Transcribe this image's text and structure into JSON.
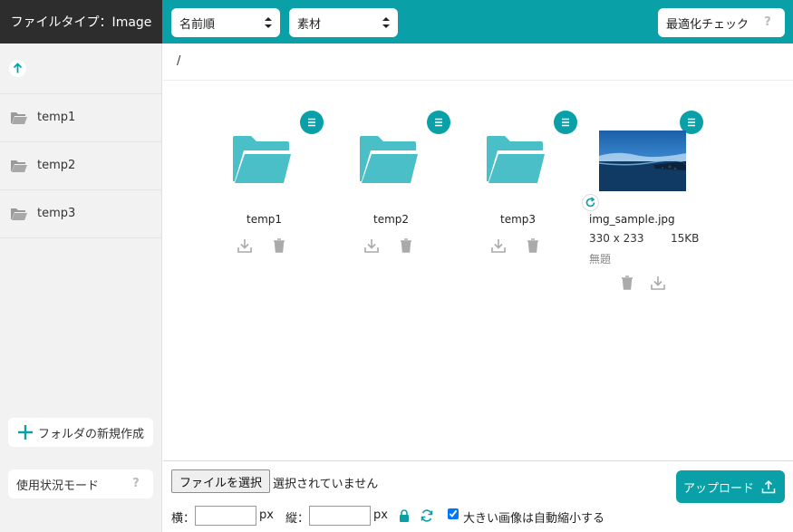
{
  "header": {
    "title": "ファイルタイプ：Image",
    "sort_select": {
      "value": "名前順",
      "options": [
        "名前順"
      ]
    },
    "type_select": {
      "value": "素材",
      "options": [
        "素材"
      ]
    },
    "optimize_label": "最適化チェック",
    "help_mark": "?"
  },
  "sidebar": {
    "up_icon": "arrow-up-icon",
    "folders": [
      {
        "label": "temp1"
      },
      {
        "label": "temp2"
      },
      {
        "label": "temp3"
      }
    ],
    "new_folder_label": "フォルダの新規作成",
    "usage_label": "使用状況モード",
    "usage_help": "?"
  },
  "main": {
    "path": "/",
    "items": [
      {
        "name": "temp1",
        "kind": "folder"
      },
      {
        "name": "temp2",
        "kind": "folder"
      },
      {
        "name": "temp3",
        "kind": "folder"
      },
      {
        "name": "img_sample.jpg",
        "kind": "image",
        "dimensions": "330 x 233",
        "size": "15KB",
        "title": "無題"
      }
    ]
  },
  "footer": {
    "choose_file_label": "ファイルを選択",
    "no_file_label": "選択されていません",
    "upload_label": "アップロード",
    "width_label": "横：",
    "height_label": "縦：",
    "unit_px": "px",
    "width_value": "",
    "height_value": "",
    "auto_shrink_label": "大きい画像は自動縮小する",
    "auto_shrink_checked": true
  },
  "colors": {
    "accent": "#0aa0a8",
    "brand_bg": "#2d2d2d",
    "folder": "#4bbfc8",
    "sidebar_bg": "#f2f2f2"
  }
}
